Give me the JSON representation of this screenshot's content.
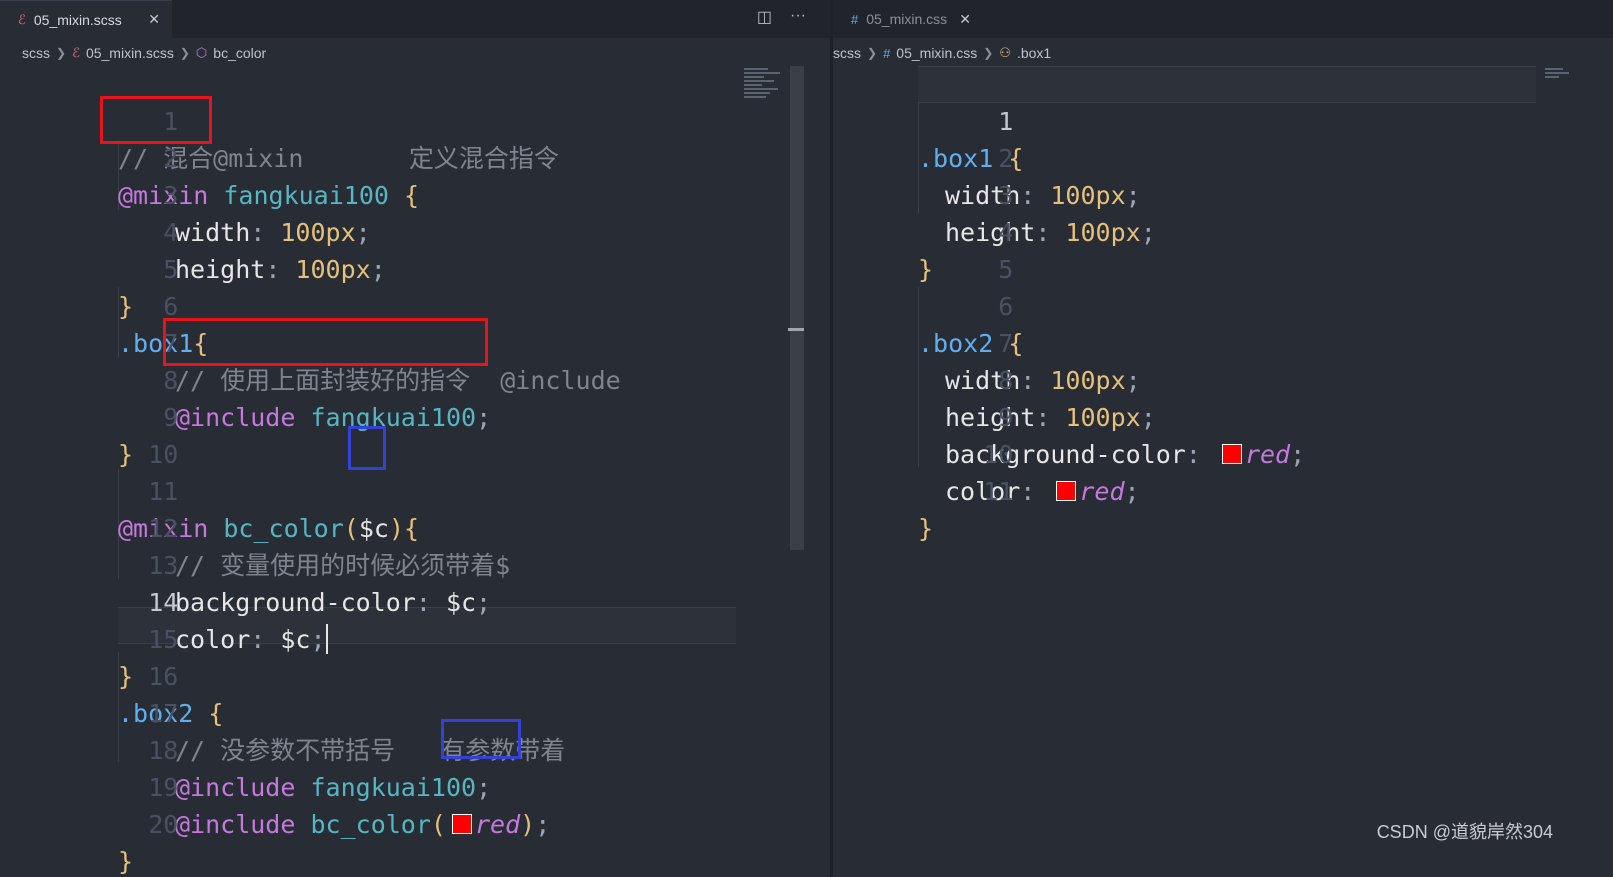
{
  "left_editor": {
    "tab": {
      "icon": "sass-file-icon",
      "label": "05_mixin.scss",
      "close": "✕"
    },
    "actions": {
      "split": "◫",
      "more": "···"
    },
    "breadcrumb": {
      "part1": "scss",
      "part2": "05_mixin.scss",
      "part3": "bc_color"
    },
    "lines": [
      {
        "n": "1",
        "c": "// 混合@mixin       定义混合指令"
      },
      {
        "n": "2",
        "kw": "@mixin",
        "fn": "fangkuai100",
        "tail": "{"
      },
      {
        "n": "3",
        "prop": "width",
        "num": "100px"
      },
      {
        "n": "4",
        "prop": "height",
        "num": "100px"
      },
      {
        "n": "5",
        "tail": "}"
      },
      {
        "n": "6",
        "sel": ".box1",
        "tail": "{"
      },
      {
        "n": "7",
        "c": "// 使用上面封装好的指令  @include"
      },
      {
        "n": "8",
        "kw": "@include",
        "fn": "fangkuai100",
        "tail": ";"
      },
      {
        "n": "9",
        "tail": "}"
      },
      {
        "n": "10"
      },
      {
        "n": "11",
        "kw": "@mixin",
        "fn": "bc_color",
        "var": "$c"
      },
      {
        "n": "12",
        "c": "// 变量使用的时候必须带着$"
      },
      {
        "n": "13",
        "prop": "background-color",
        "var": "$c"
      },
      {
        "n": "14",
        "prop": "color",
        "var": "$c"
      },
      {
        "n": "15",
        "tail": "}"
      },
      {
        "n": "16",
        "sel": ".box2",
        "tail": "{"
      },
      {
        "n": "17",
        "c": "// 没参数不带括号   有参数带着"
      },
      {
        "n": "18",
        "kw": "@include",
        "fn": "fangkuai100",
        "tail": ";"
      },
      {
        "n": "19",
        "kw": "@include",
        "fn": "bc_color",
        "arg": "red"
      },
      {
        "n": "20",
        "tail": "}"
      }
    ]
  },
  "right_editor": {
    "tab": {
      "icon": "css-file-icon",
      "label": "05_mixin.css",
      "close": "✕"
    },
    "breadcrumb": {
      "part1": "scss",
      "part2": "05_mixin.css",
      "part3": ".box1"
    },
    "lines": [
      {
        "n": "1",
        "sel": ".box1",
        "tail": "{"
      },
      {
        "n": "2",
        "prop": "width",
        "num": "100px"
      },
      {
        "n": "3",
        "prop": "height",
        "num": "100px"
      },
      {
        "n": "4",
        "tail": "}"
      },
      {
        "n": "5"
      },
      {
        "n": "6",
        "sel": ".box2",
        "tail": "{"
      },
      {
        "n": "7",
        "prop": "width",
        "num": "100px"
      },
      {
        "n": "8",
        "prop": "height",
        "num": "100px"
      },
      {
        "n": "9",
        "prop": "background-color",
        "val": "red"
      },
      {
        "n": "10",
        "prop": "color",
        "val": "red"
      },
      {
        "n": "11",
        "tail": "}"
      }
    ]
  },
  "watermark": "CSDN @道貌岸然304",
  "colors": {
    "swatch": "#ff0000",
    "highlight_red": "#e5141d",
    "highlight_blue": "#3341d6"
  }
}
